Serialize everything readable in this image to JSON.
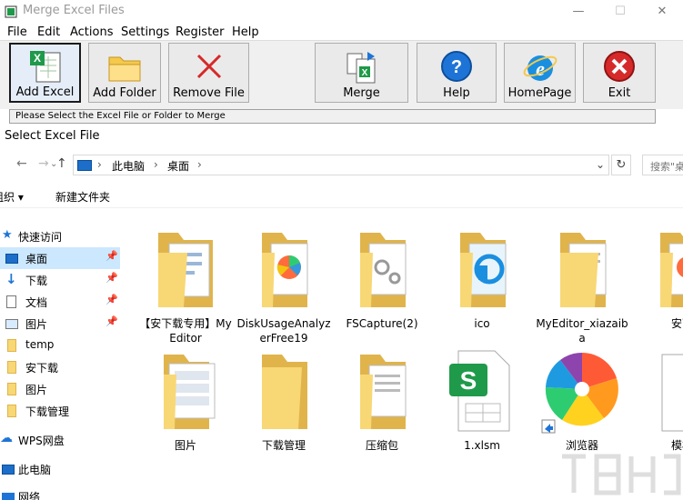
{
  "window": {
    "title": "Merge Excel Files",
    "controls": {
      "minimize": "—",
      "maximize": "☐",
      "close": "✕"
    }
  },
  "menu": [
    "File",
    "Edit",
    "Actions",
    "Settings",
    "Register",
    "Help"
  ],
  "toolbar": {
    "add_excel": "Add Excel",
    "add_folder": "Add Folder",
    "remove_file": "Remove File",
    "merge": "Merge",
    "help": "Help",
    "homepage": "HomePage",
    "exit": "Exit"
  },
  "status": "Please Select the Excel File or Folder to Merge",
  "dialog": {
    "title": "Select Excel File",
    "back": "←",
    "forward": "→",
    "recent": "⌄",
    "up": "↑",
    "address": {
      "sep1": "›",
      "part1": "此电脑",
      "sep2": "›",
      "part2": "桌面",
      "sep3": "›",
      "dropdown": "⌄"
    },
    "refresh": "↻",
    "search_placeholder": "搜索\"桌面\"",
    "commands": {
      "organize": "组织 ▾",
      "new_folder": "新建文件夹"
    },
    "nav": [
      {
        "label": "快速访问",
        "icon": "star-icon"
      },
      {
        "label": "桌面",
        "icon": "desktop-icon",
        "pin": true,
        "selected": true
      },
      {
        "label": "下载",
        "icon": "download-icon",
        "pin": true
      },
      {
        "label": "文档",
        "icon": "document-icon",
        "pin": true
      },
      {
        "label": "图片",
        "icon": "picture-icon",
        "pin": true
      },
      {
        "label": "temp",
        "icon": "folder-icon"
      },
      {
        "label": "安下载",
        "icon": "folder-icon"
      },
      {
        "label": "图片",
        "icon": "folder-icon"
      },
      {
        "label": "下载管理",
        "icon": "folder-icon"
      },
      {
        "label": "WPS网盘",
        "icon": "cloud-icon"
      },
      {
        "label": "此电脑",
        "icon": "computer-icon"
      },
      {
        "label": "网络",
        "icon": "network-icon"
      }
    ],
    "pin_glyph": "📌",
    "files_row1": [
      {
        "name": "【安下载专用】MyEditor",
        "kind": "folder-doc"
      },
      {
        "name": "DiskUsageAnalyzerFree19",
        "kind": "folder-pinwheel"
      },
      {
        "name": "FSCapture(2)",
        "kind": "folder-gear"
      },
      {
        "name": "ico",
        "kind": "folder-ico"
      },
      {
        "name": "MyEditor_xiazaiba",
        "kind": "folder-plain-doc"
      },
      {
        "name": "安下",
        "kind": "folder-pinwheel"
      }
    ],
    "files_row2": [
      {
        "name": "图片",
        "kind": "folder-screens"
      },
      {
        "name": "下载管理",
        "kind": "folder-empty"
      },
      {
        "name": "压缩包",
        "kind": "folder-doc2"
      },
      {
        "name": "1.xlsm",
        "kind": "xlsm"
      },
      {
        "name": "浏览器",
        "kind": "browser"
      },
      {
        "name": "模板",
        "kind": "doc"
      }
    ]
  },
  "colors": {
    "selection": "#cce8ff",
    "folder": "#f8d775",
    "folder_dark": "#e0b44b",
    "exit_red": "#d62929",
    "help_blue": "#1e74d6",
    "ie_blue": "#1a8fe0",
    "excel_green": "#1f9a4a"
  }
}
